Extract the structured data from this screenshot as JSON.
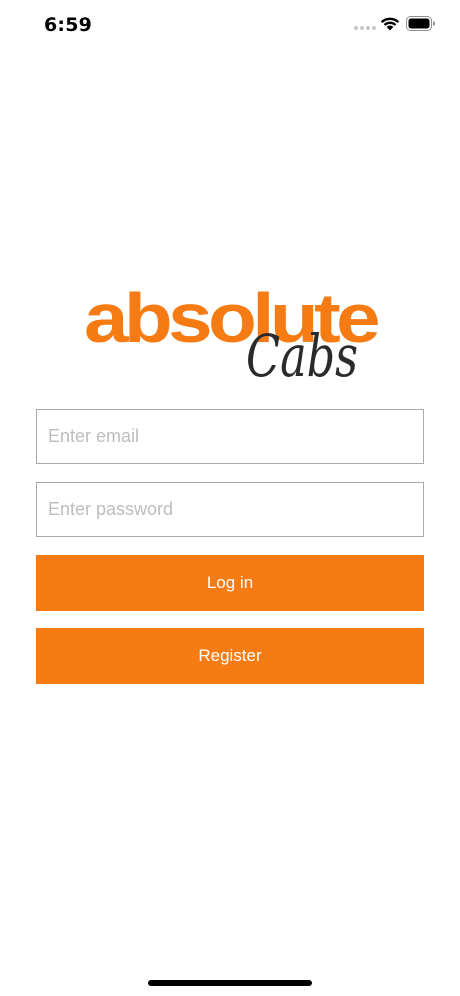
{
  "status_bar": {
    "time": "6:59",
    "icons": [
      "signal-dots-icon",
      "wifi-icon",
      "battery-icon"
    ]
  },
  "logo": {
    "wordmark": "absolute",
    "script": "Cabs",
    "brand_color": "#f77b13",
    "script_color": "#2b2b2b"
  },
  "login_form": {
    "email_placeholder": "Enter email",
    "email_value": "",
    "password_placeholder": "Enter password",
    "password_value": "",
    "login_label": "Log in",
    "register_label": "Register"
  },
  "colors": {
    "button": "#f77b13",
    "field_border": "#a9a9a9",
    "placeholder": "#bdbdbd"
  }
}
